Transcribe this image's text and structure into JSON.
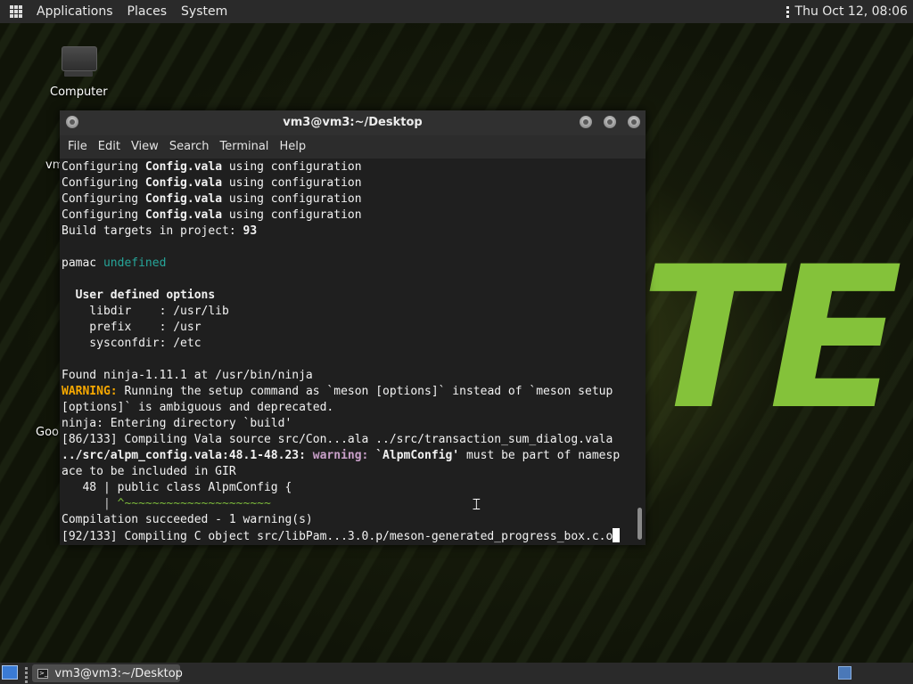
{
  "top_panel": {
    "menus": [
      "Applications",
      "Places",
      "System"
    ],
    "clock": "Thu Oct 12, 08:06"
  },
  "desktop": {
    "icons": [
      {
        "label": "Computer",
        "icon": "computer-icon"
      }
    ],
    "peek_labels": [
      "vm",
      "Goo"
    ],
    "wallpaper_text": "TE"
  },
  "terminal": {
    "title": "vm3@vm3:~/Desktop",
    "menu": [
      "File",
      "Edit",
      "View",
      "Search",
      "Terminal",
      "Help"
    ],
    "lines": [
      [
        {
          "t": "Configuring "
        },
        {
          "t": "Config.vala",
          "s": "b"
        },
        {
          "t": " using configuration"
        }
      ],
      [
        {
          "t": "Configuring "
        },
        {
          "t": "Config.vala",
          "s": "b"
        },
        {
          "t": " using configuration"
        }
      ],
      [
        {
          "t": "Configuring "
        },
        {
          "t": "Config.vala",
          "s": "b"
        },
        {
          "t": " using configuration"
        }
      ],
      [
        {
          "t": "Configuring "
        },
        {
          "t": "Config.vala",
          "s": "b"
        },
        {
          "t": " using configuration"
        }
      ],
      [
        {
          "t": "Build targets in project: "
        },
        {
          "t": "93",
          "s": "b"
        }
      ],
      [],
      [
        {
          "t": "pamac "
        },
        {
          "t": "undefined",
          "s": "teal"
        }
      ],
      [],
      [
        {
          "t": "  "
        },
        {
          "t": "User defined options",
          "s": "b"
        }
      ],
      [
        {
          "t": "    libdir    : /usr/lib"
        }
      ],
      [
        {
          "t": "    prefix    : /usr"
        }
      ],
      [
        {
          "t": "    sysconfdir: /etc"
        }
      ],
      [],
      [
        {
          "t": "Found ninja-1.11.1 at /usr/bin/ninja"
        }
      ],
      [
        {
          "t": "WARNING:",
          "s": "orange"
        },
        {
          "t": " Running the setup command as `meson [options]` instead of `meson setup"
        }
      ],
      [
        {
          "t": "[options]` is ambiguous and deprecated."
        }
      ],
      [
        {
          "t": "ninja: Entering directory `build'"
        }
      ],
      [
        {
          "t": "[86/133] Compiling Vala source src/Con...ala ../src/transaction_sum_dialog.vala"
        }
      ],
      [
        {
          "t": "../src/alpm_config.vala:48.1-48.23:",
          "s": "b"
        },
        {
          "t": " "
        },
        {
          "t": "warning:",
          "s": "pink"
        },
        {
          "t": " "
        },
        {
          "t": "`AlpmConfig'",
          "s": "b"
        },
        {
          "t": " must be part of namesp"
        }
      ],
      [
        {
          "t": "ace to be included in GIR"
        }
      ],
      [
        {
          "t": "   48 | public class AlpmConfig {"
        }
      ],
      [
        {
          "t": "      | ",
          "s": "dim"
        },
        {
          "t": "^~~~~~~~~~~~~~~~~~~~~~",
          "s": "green"
        }
      ],
      [
        {
          "t": "Compilation succeeded - 1 warning(s)"
        }
      ],
      [
        {
          "t": "[92/133] Compiling C object src/libPam...3.0.p/meson-generated_progress_box.c.o"
        },
        {
          "cursor": true
        }
      ]
    ]
  },
  "bottom_panel": {
    "task_label": "vm3@vm3:~/Desktop",
    "task_icon_text": ">_"
  }
}
